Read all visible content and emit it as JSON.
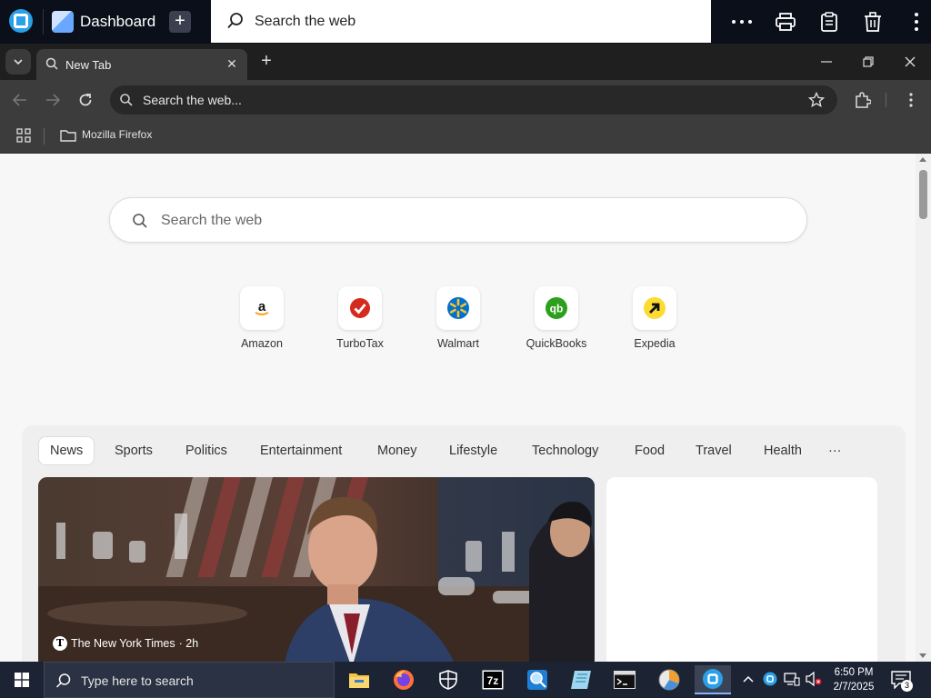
{
  "dashboard": {
    "title": "Dashboard",
    "search_placeholder": "Search the web",
    "accent": "#2aa0e8"
  },
  "browser": {
    "tab_title": "New Tab",
    "address_text": "Search the web...",
    "bookmarks": [
      {
        "label": "Mozilla Firefox"
      }
    ]
  },
  "page": {
    "search_placeholder": "Search the web",
    "shortcuts": [
      {
        "label": "Amazon",
        "icon": "amazon-icon",
        "color": "#ff9900"
      },
      {
        "label": "TurboTax",
        "icon": "turbotax-icon",
        "color": "#d52b1e"
      },
      {
        "label": "Walmart",
        "icon": "walmart-icon",
        "color": "#0071ce"
      },
      {
        "label": "QuickBooks",
        "icon": "quickbooks-icon",
        "color": "#2ca01c"
      },
      {
        "label": "Expedia",
        "icon": "expedia-icon",
        "color": "#fddb32"
      }
    ],
    "feed_tabs": [
      {
        "label": "News"
      },
      {
        "label": "Sports"
      },
      {
        "label": "Politics"
      },
      {
        "label": "Entertainment"
      },
      {
        "label": "Money"
      },
      {
        "label": "Lifestyle"
      },
      {
        "label": "Technology"
      },
      {
        "label": "Food"
      },
      {
        "label": "Travel"
      },
      {
        "label": "Health"
      },
      {
        "label": "···"
      }
    ],
    "news_card": {
      "source": "The New York Times",
      "age": "· 2h"
    }
  },
  "taskbar": {
    "search_placeholder": "Type here to search",
    "time": "6:50 PM",
    "date": "2/7/2025",
    "notification_count": "3"
  }
}
